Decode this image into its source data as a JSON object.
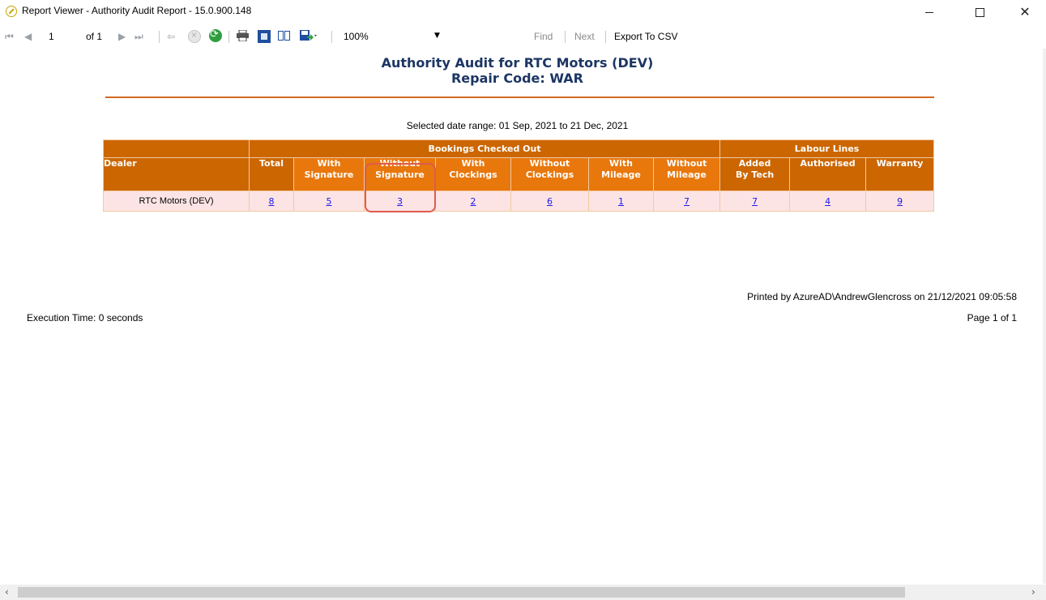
{
  "window": {
    "title": "Report Viewer - Authority Audit Report - 15.0.900.148",
    "controls": [
      "minimize",
      "maximize",
      "close"
    ]
  },
  "toolbar": {
    "first_icon": "⏮",
    "prev_icon": "◀",
    "page_value": "1",
    "of_pages": "of 1",
    "next_icon": "▶",
    "last_icon": "⏭",
    "back_icon": "⇦",
    "zoom": "100%",
    "find_label": "Find",
    "next_label": "Next",
    "export_label": "Export To CSV"
  },
  "report": {
    "title": "Authority Audit for RTC Motors (DEV)",
    "subtitle": "Repair Code: WAR",
    "date_range": "Selected date range: 01 Sep, 2021 to 21 Dec, 2021",
    "group_headers": {
      "bookings": "Bookings Checked Out",
      "labour": "Labour Lines"
    },
    "columns": [
      [
        "Dealer"
      ],
      [
        "Total"
      ],
      [
        "With",
        "Signature"
      ],
      [
        "Without",
        "Signature"
      ],
      [
        "With",
        "Clockings"
      ],
      [
        "Without",
        "Clockings"
      ],
      [
        "With",
        "Mileage"
      ],
      [
        "Without",
        "Mileage"
      ],
      [
        "Added",
        "By Tech"
      ],
      [
        "Authorised"
      ],
      [
        "Warranty"
      ]
    ],
    "rows": [
      {
        "dealer": "RTC Motors (DEV)",
        "values": [
          "8",
          "5",
          "3",
          "2",
          "6",
          "1",
          "7",
          "7",
          "4",
          "9"
        ]
      }
    ],
    "printed_by": "Printed by AzureAD\\AndrewGlencross on 21/12/2021 09:05:58",
    "execution_time": "Execution Time: 0 seconds",
    "page_of": "Page 1 of 1"
  },
  "colors": {
    "header_dark": "#cc6600",
    "header_light": "#e8770c",
    "row_bg": "#fde4e4",
    "title_color": "#1c3664",
    "highlight": "#e05a4e"
  }
}
